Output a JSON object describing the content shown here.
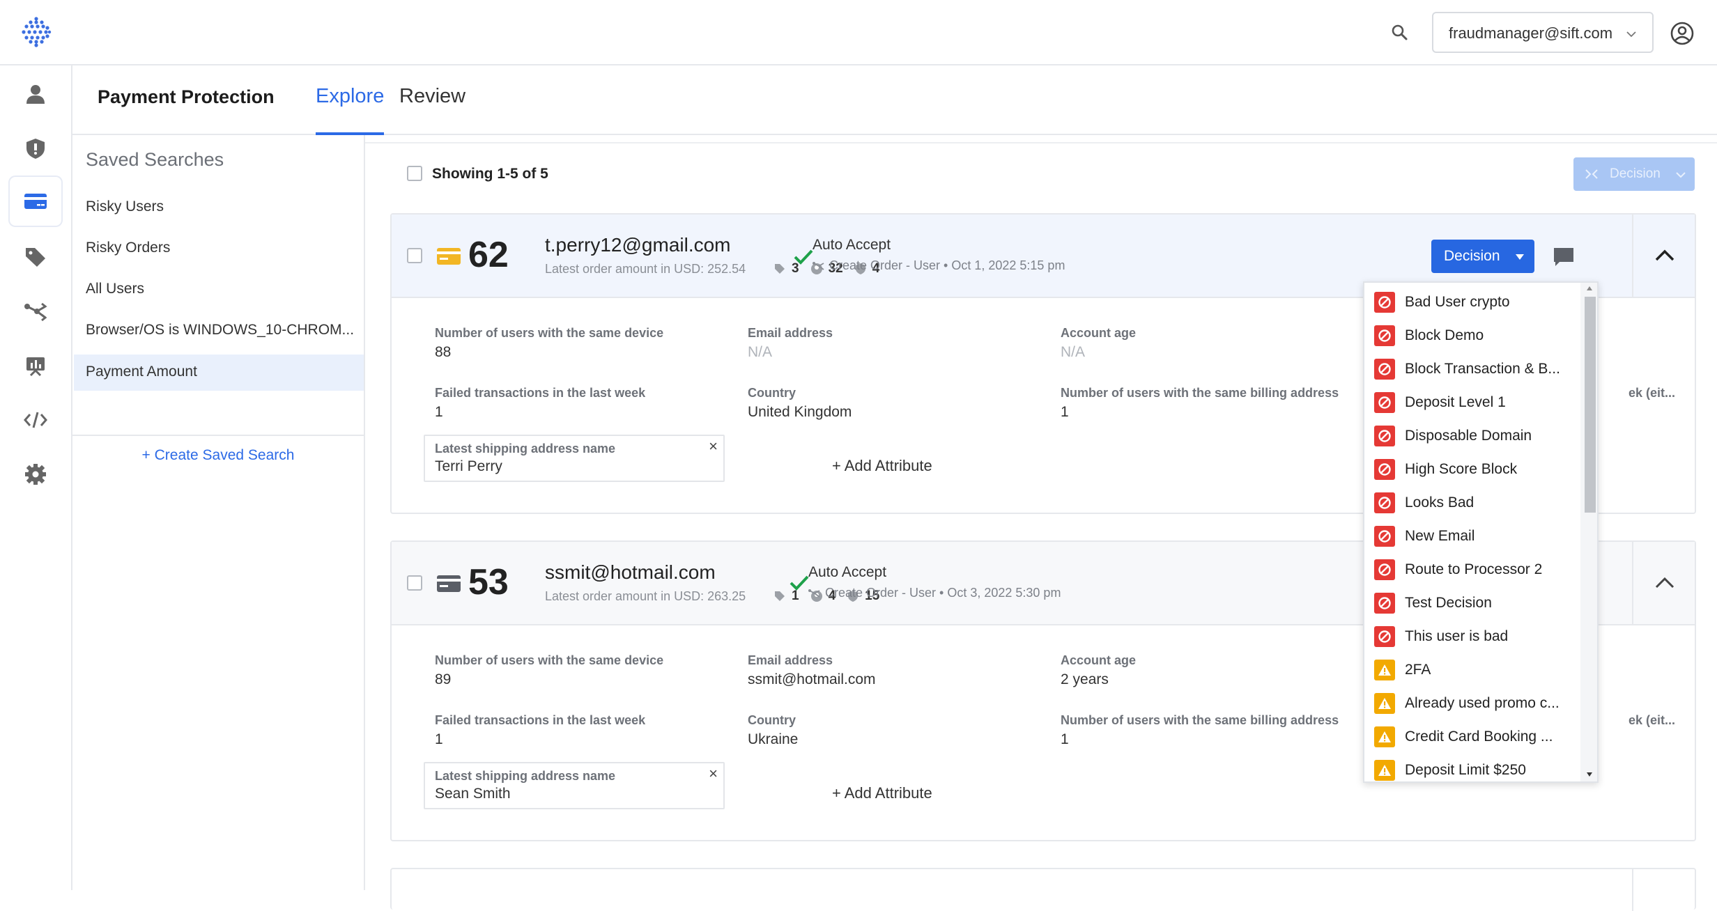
{
  "account": {
    "email": "fraudmanager@sift.com"
  },
  "app": {
    "title": "Payment Protection",
    "tabs": [
      {
        "label": "Explore",
        "active": true
      },
      {
        "label": "Review",
        "active": false
      }
    ]
  },
  "saved_searches": {
    "title": "Saved Searches",
    "items": [
      {
        "label": "Risky Users"
      },
      {
        "label": "Risky Orders"
      },
      {
        "label": "All Users"
      },
      {
        "label": "Browser/OS is WINDOWS_10-CHROM..."
      },
      {
        "label": "Payment Amount",
        "active": true
      }
    ],
    "create_label": "+ Create Saved Search"
  },
  "results": {
    "showing": "Showing 1-5 of 5",
    "bulk_decision_label": "Decision"
  },
  "cards": [
    {
      "score": "62",
      "score_color": "#f2b624",
      "email": "t.perry12@gmail.com",
      "subline": "Latest order amount in USD: 252.54",
      "counts": {
        "tags": "3",
        "users": "32",
        "shields": "4"
      },
      "status": "Auto Accept",
      "status_sub": "Create Order - User • Oct 1, 2022 5:15 pm",
      "decision_label": "Decision",
      "attributes": [
        {
          "label": "Number of users with the same device",
          "value": "88"
        },
        {
          "label": "Email address",
          "value": "N/A"
        },
        {
          "label": "Account age",
          "value": "N/A"
        },
        {
          "label": "Failed transactions in the last week",
          "value": "1"
        },
        {
          "label": "Country",
          "value": "United Kingdom"
        },
        {
          "label": "Number of users with the same billing address",
          "value": "1"
        }
      ],
      "partial_attr_label": "ek (eit...",
      "ship_label": "Latest shipping address name",
      "ship_value": "Terri Perry",
      "add_attribute": "+ Add Attribute"
    },
    {
      "score": "53",
      "score_color": "#5a5e66",
      "email": "ssmit@hotmail.com",
      "subline": "Latest order amount in USD: 263.25",
      "counts": {
        "tags": "1",
        "users": "4",
        "shields": "15"
      },
      "status": "Auto Accept",
      "status_sub": "Create Order - User • Oct 3, 2022 5:30 pm",
      "attributes": [
        {
          "label": "Number of users with the same device",
          "value": "89"
        },
        {
          "label": "Email address",
          "value": "ssmit@hotmail.com"
        },
        {
          "label": "Account age",
          "value": "2 years"
        },
        {
          "label": "Failed transactions in the last week",
          "value": "1"
        },
        {
          "label": "Country",
          "value": "Ukraine"
        },
        {
          "label": "Number of users with the same billing address",
          "value": "1"
        }
      ],
      "partial_attr_label": "ek (eit...",
      "ship_label": "Latest shipping address name",
      "ship_value": "Sean Smith",
      "add_attribute": "+ Add Attribute"
    }
  ],
  "decision_menu": {
    "colors": {
      "block": "#e53935",
      "watch": "#f2a900"
    },
    "items": [
      {
        "label": "Bad User crypto",
        "kind": "block"
      },
      {
        "label": "Block Demo",
        "kind": "block"
      },
      {
        "label": "Block Transaction & B...",
        "kind": "block"
      },
      {
        "label": "Deposit Level 1",
        "kind": "block"
      },
      {
        "label": "Disposable Domain",
        "kind": "block"
      },
      {
        "label": "High Score Block",
        "kind": "block"
      },
      {
        "label": "Looks Bad",
        "kind": "block"
      },
      {
        "label": "New Email",
        "kind": "block"
      },
      {
        "label": "Route to Processor 2",
        "kind": "block"
      },
      {
        "label": "Test Decision",
        "kind": "block"
      },
      {
        "label": "This user is bad",
        "kind": "block"
      },
      {
        "label": "2FA",
        "kind": "watch"
      },
      {
        "label": "Already used promo c...",
        "kind": "watch"
      },
      {
        "label": "Credit Card Booking ...",
        "kind": "watch"
      },
      {
        "label": "Deposit Limit $250",
        "kind": "watch"
      }
    ]
  }
}
